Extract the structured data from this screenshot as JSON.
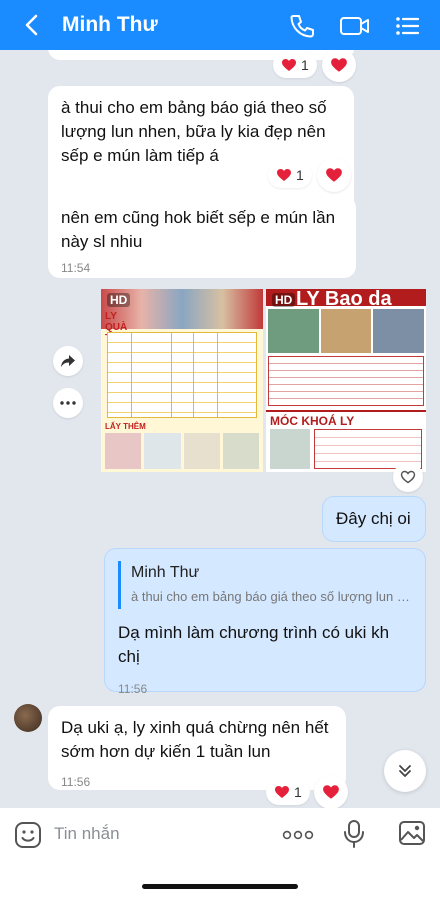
{
  "header": {
    "title": "Minh Thư",
    "icons": [
      "back-chevron-icon",
      "phone-icon",
      "video-call-icon",
      "menu-list-icon"
    ]
  },
  "reactions": {
    "count_1": "1",
    "count_2": "1",
    "count_3": "1"
  },
  "messages": [
    {
      "text": "à thui cho em bảng báo giá theo số lượng lun nhen, bữa ly kia đẹp nên sếp e mún làm tiếp á"
    },
    {
      "text": "nên em cũng hok biết sếp e mún lần này sl nhiu",
      "time": "11:54"
    },
    {
      "text": "Đây chị oi"
    },
    {
      "reply_name": "Minh Thư",
      "reply_quote": "à thui cho em bảng báo giá theo số lượng lun nhen, bữa ly kia đẹp nên sếp e mún làm tiếp á",
      "text": "Dạ mình làm chương trình có uki kh chị",
      "time": "11:56"
    },
    {
      "text": "Dạ uki ạ, ly xinh quá chừng nên hết sớm hơn dự kiến 1 tuần lun",
      "time": "11:56"
    }
  ],
  "images": [
    {
      "badge": "HD",
      "title": "LY QUÀ TẶNG",
      "footer": "LẤY THÊM"
    },
    {
      "badge": "HD",
      "title": "LY Bao da",
      "footer": "MÓC KHOÁ LY"
    }
  ],
  "composer": {
    "placeholder": "Tin nhắn"
  },
  "colors": {
    "header": "#1a8cff",
    "chat_bg": "#e2e7ee",
    "own_bubble": "#d4e8ff",
    "heart": "#e5203a"
  }
}
